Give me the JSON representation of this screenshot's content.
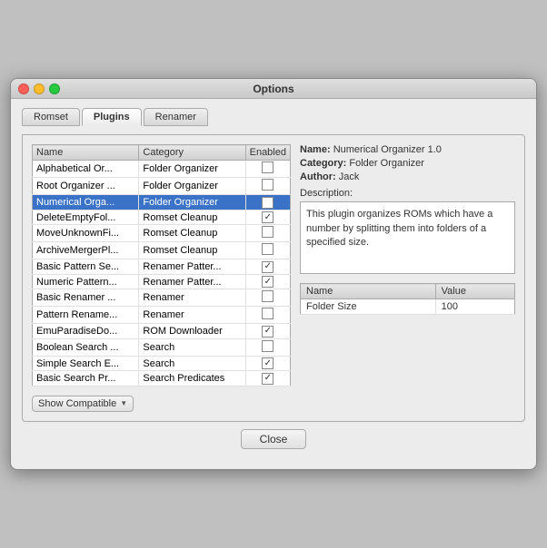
{
  "window": {
    "title": "Options"
  },
  "tabs": [
    {
      "id": "romset",
      "label": "Romset",
      "active": false
    },
    {
      "id": "plugins",
      "label": "Plugins",
      "active": true
    },
    {
      "id": "renamer",
      "label": "Renamer",
      "active": false
    }
  ],
  "table": {
    "columns": [
      {
        "id": "name",
        "label": "Name"
      },
      {
        "id": "category",
        "label": "Category"
      },
      {
        "id": "enabled",
        "label": "Enabled"
      }
    ],
    "rows": [
      {
        "name": "Alphabetical Or...",
        "category": "Folder Organizer",
        "checked": false,
        "selected": false
      },
      {
        "name": "Root Organizer ...",
        "category": "Folder Organizer",
        "checked": false,
        "selected": false
      },
      {
        "name": "Numerical Orga...",
        "category": "Folder Organizer",
        "checked": true,
        "selected": true
      },
      {
        "name": "DeleteEmptyFol...",
        "category": "Romset Cleanup",
        "checked": true,
        "selected": false
      },
      {
        "name": "MoveUnknownFi...",
        "category": "Romset Cleanup",
        "checked": false,
        "selected": false
      },
      {
        "name": "ArchiveMergerPl...",
        "category": "Romset Cleanup",
        "checked": false,
        "selected": false
      },
      {
        "name": "Basic Pattern Se...",
        "category": "Renamer Patter...",
        "checked": true,
        "selected": false
      },
      {
        "name": "Numeric Pattern...",
        "category": "Renamer Patter...",
        "checked": true,
        "selected": false
      },
      {
        "name": "Basic Renamer ...",
        "category": "Renamer",
        "checked": false,
        "selected": false
      },
      {
        "name": "Pattern Rename...",
        "category": "Renamer",
        "checked": false,
        "selected": false
      },
      {
        "name": "EmuParadiseDo...",
        "category": "ROM Downloader",
        "checked": true,
        "selected": false
      },
      {
        "name": "Boolean Search ...",
        "category": "Search",
        "checked": false,
        "selected": false
      },
      {
        "name": "Simple Search E...",
        "category": "Search",
        "checked": true,
        "selected": false
      },
      {
        "name": "Basic Search Pr...",
        "category": "Search Predicates",
        "checked": true,
        "selected": false
      }
    ]
  },
  "info": {
    "name_label": "Name:",
    "name_value": "Numerical Organizer 1.0",
    "category_label": "Category:",
    "category_value": "Folder Organizer",
    "author_label": "Author:",
    "author_value": "Jack",
    "description_label": "Description:",
    "description_text": "This plugin organizes ROMs which have a number by splitting them into folders of a specified size."
  },
  "props": {
    "columns": [
      {
        "id": "name",
        "label": "Name"
      },
      {
        "id": "value",
        "label": "Value"
      }
    ],
    "rows": [
      {
        "name": "Folder Size",
        "value": "100"
      }
    ]
  },
  "show_compatible_label": "Show Compatible",
  "close_label": "Close"
}
